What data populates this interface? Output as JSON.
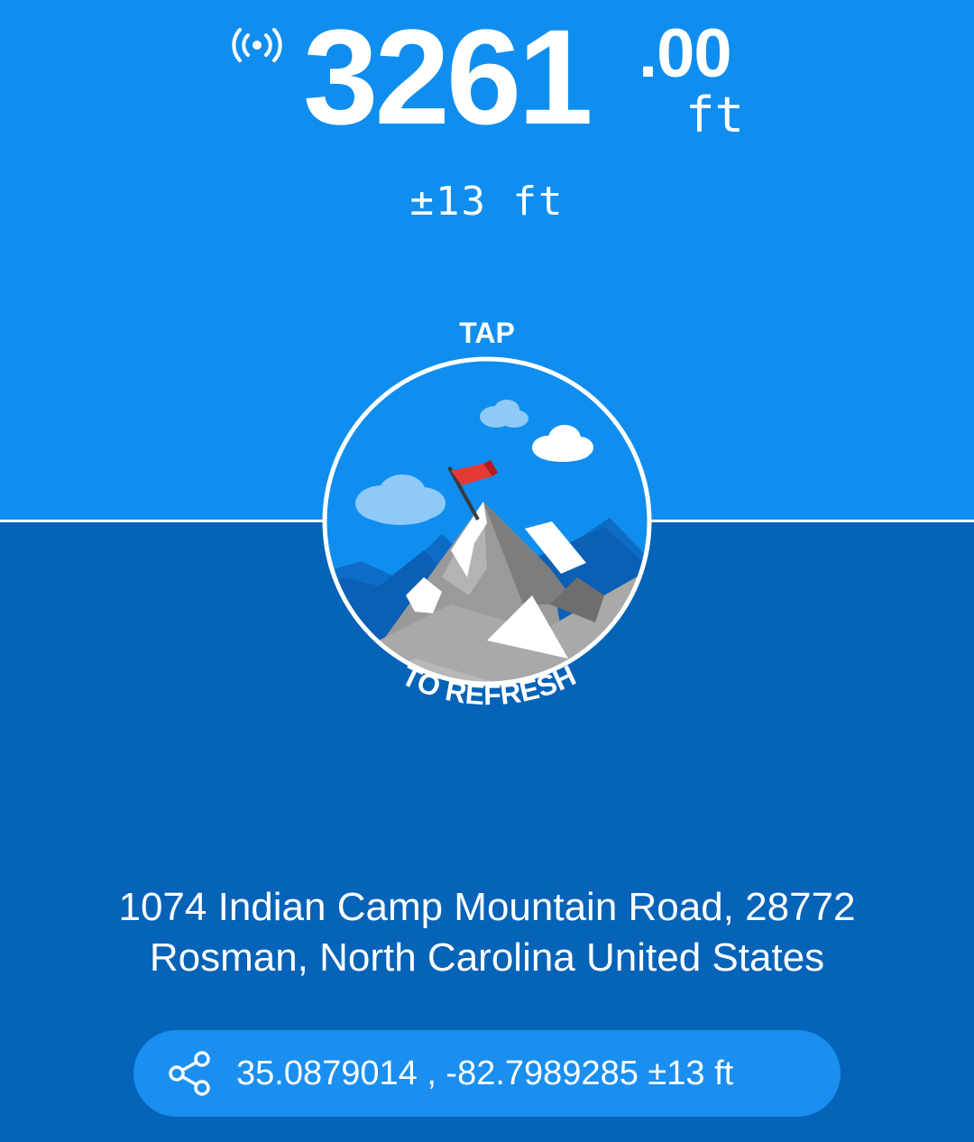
{
  "altitude": {
    "integer": "3261",
    "decimal": ".00",
    "unit": "ft",
    "accuracy": "±13 ft"
  },
  "badge": {
    "top_text": "TAP",
    "bottom_text": "TO REFRESH"
  },
  "address": {
    "line1": "1074 Indian Camp Mountain Road, 28772",
    "line2": "Rosman, North Carolina United States"
  },
  "coordinates": {
    "text": "35.0879014 , -82.7989285 ±13 ft"
  },
  "icons": {
    "gps": "gps-signal-icon",
    "share": "share-icon",
    "illustration": "mountain-summit-flag-illustration"
  },
  "colors": {
    "top_background": "#0f8eef",
    "bottom_background": "#0563b8",
    "pill_background": "#1a8ff0",
    "flag": "#e53935"
  }
}
